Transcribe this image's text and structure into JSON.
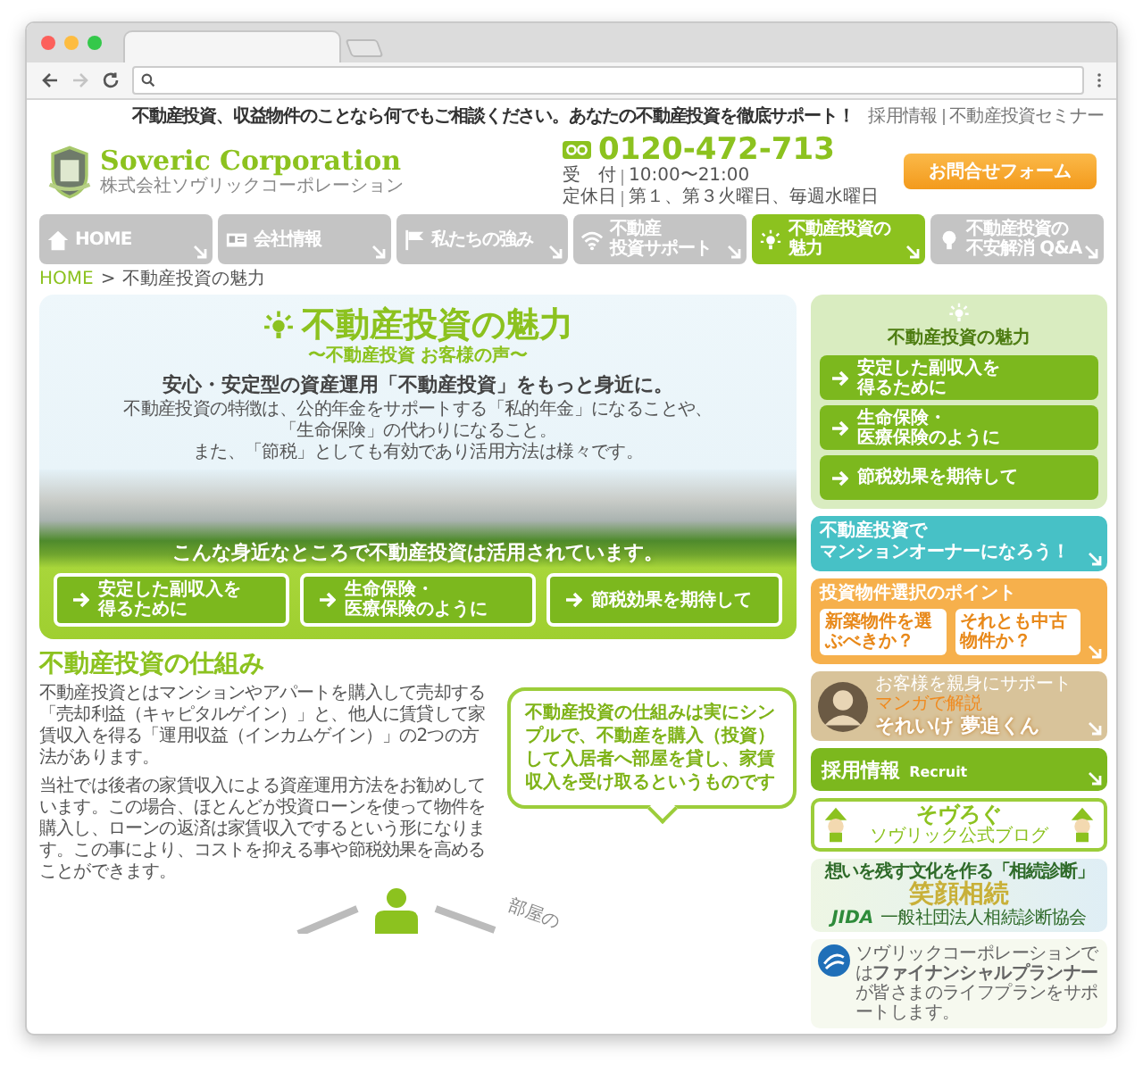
{
  "browser": {
    "nav_buttons": [
      {
        "kind": "back",
        "disabled": false
      },
      {
        "kind": "forward",
        "disabled": true
      },
      {
        "kind": "reload",
        "disabled": false
      }
    ]
  },
  "top_bar": {
    "tagline": "不動産投資、収益物件のことなら何でもご相談ください。あなたの不動産投資を徹底サポート！",
    "links": [
      "採用情報",
      "不動産投資セミナー"
    ]
  },
  "header": {
    "logo_name": "Soveric Corporation",
    "logo_subtitle": "株式会社ソヴリックコーポレーション",
    "phone": "0120-472-713",
    "hours": [
      {
        "label": "受　付",
        "value": "10:00〜21:00"
      },
      {
        "label": "定休日",
        "value": "第１、第３火曜日、毎週水曜日"
      }
    ],
    "contact_button": "お問合せフォーム"
  },
  "nav": [
    {
      "kind": "house",
      "lines": [
        "HOME"
      ],
      "selected": false
    },
    {
      "kind": "card",
      "lines": [
        "会社情報"
      ],
      "selected": false
    },
    {
      "kind": "flag",
      "lines": [
        "私たちの強み"
      ],
      "selected": false
    },
    {
      "kind": "wifi",
      "lines": [
        "不動産",
        "投資サポート"
      ],
      "selected": false
    },
    {
      "kind": "sun",
      "lines": [
        "不動産投資の",
        "魅力"
      ],
      "selected": true
    },
    {
      "kind": "bulb",
      "lines": [
        "不動産投資の",
        "不安解消 Q&A"
      ],
      "selected": false
    }
  ],
  "breadcrumb": {
    "home": "HOME",
    "separator": ">",
    "current": "不動産投資の魅力"
  },
  "hero": {
    "title": "不動産投資の魅力",
    "subtitle": "〜不動産投資 お客様の声〜",
    "lead": "安心・安定型の資産運用「不動産投資」をもっと身近に。",
    "description": [
      "不動産投資の特徴は、公的年金をサポートする「私的年金」になることや、",
      "「生命保険」の代わりになること。",
      "また、「節税」としても有効であり活用方法は様々です。"
    ],
    "caption": "こんな身近なところで不動産投資は活用されています。",
    "buttons": [
      {
        "lines": [
          "安定した副収入を",
          "得るために"
        ]
      },
      {
        "lines": [
          "生命保険・",
          "医療保険のように"
        ]
      },
      {
        "lines": [
          "節税効果を期待して"
        ]
      }
    ]
  },
  "section": {
    "heading": "不動産投資の仕組み",
    "paragraphs": [
      "不動産投資とはマンションやアパートを購入して売却する「売却利益（キャピタルゲイン）」と、他人に賃貸して家賃収入を得る「運用収益（インカムゲイン）」の2つの方法があります。",
      "当社では後者の家賃収入による資産運用方法をお勧めしています。この場合、ほとんどが投資ローンを使って物件を購入し、ローンの返済は家賃収入でするという形になります。この事により、コストを抑える事や節税効果を高めることができます。"
    ],
    "callout": "不動産投資の仕組みは実にシンプルで、不動産を購入（投資）して入居者へ部屋を貸し、家賃収入を受け取るというものです",
    "diagram_label": "部屋の"
  },
  "sidebar": {
    "menu": {
      "title": "不動産投資の魅力",
      "items": [
        {
          "lines": [
            "安定した副収入を",
            "得るために"
          ]
        },
        {
          "lines": [
            "生命保険・",
            "医療保険のように"
          ]
        },
        {
          "lines": [
            "節税効果を期待して"
          ]
        }
      ]
    },
    "banners": [
      {
        "kind": "owner",
        "lines": [
          "不動産投資で",
          "マンションオーナーになろう！"
        ]
      },
      {
        "kind": "points",
        "title": "投資物件選択のポイント",
        "bubbles": [
          "新築物件を選ぶべきか？",
          "それとも中古物件か？"
        ]
      },
      {
        "kind": "manga",
        "lines": [
          "お客様を親身にサポート",
          "マンガで解説",
          "それいけ 夢追くん"
        ]
      },
      {
        "kind": "recruit",
        "lines": [
          "採用情報",
          "Recruit"
        ]
      },
      {
        "kind": "blog",
        "lines": [
          "そヴろぐ",
          "ソヴリック公式ブログ"
        ]
      },
      {
        "kind": "jida",
        "lines": [
          "想いを残す文化を作る「相続診断」",
          "笑顔相続",
          "JIDA",
          "一般社団法人相続診断協会"
        ]
      },
      {
        "kind": "fp",
        "text": "ソヴリックコーポレーションでは**ファイナンシャルプランナー**が皆さまのライフプランをサポートします。"
      }
    ]
  }
}
